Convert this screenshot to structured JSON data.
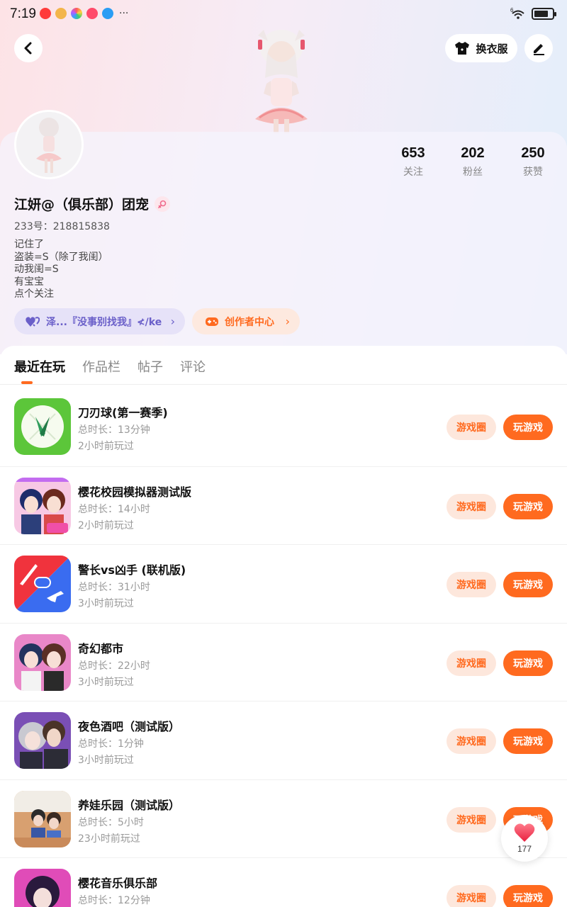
{
  "status_bar": {
    "time": "7:19",
    "more": "···",
    "signal": "6",
    "battery_level": 0.8
  },
  "header": {
    "back_icon": "chevron-left-icon",
    "outfit_label": "换衣服",
    "edit_icon": "pencil-icon"
  },
  "profile": {
    "stats": [
      {
        "value": "653",
        "label": "关注"
      },
      {
        "value": "202",
        "label": "粉丝"
      },
      {
        "value": "250",
        "label": "获赞"
      }
    ],
    "username": "江妍@（俱乐部）团宠",
    "gender_icon": "female-icon",
    "uid": "233号：218815838",
    "bio": [
      "记住了",
      "盗装=S（除了我闺）",
      "动我闺=S",
      "有宝宝",
      "点个关注"
    ],
    "club_chip": "泽...『没事别找我』≮/ke",
    "creator_chip": "创作者中心"
  },
  "tabs": [
    "最近在玩",
    "作品栏",
    "帖子",
    "评论"
  ],
  "active_tab": 0,
  "games": [
    {
      "title": "刀刃球(第一赛季)",
      "duration": "总时长：13分钟",
      "last_played": "2小时前玩过"
    },
    {
      "title": "樱花校园模拟器测试版",
      "duration": "总时长：14小时",
      "last_played": "2小时前玩过"
    },
    {
      "title": "警长vs凶手 (联机版)",
      "duration": "总时长：31小时",
      "last_played": "3小时前玩过"
    },
    {
      "title": "奇幻都市",
      "duration": "总时长：22小时",
      "last_played": "3小时前玩过"
    },
    {
      "title": "夜色酒吧（测试版）",
      "duration": "总时长：1分钟",
      "last_played": "3小时前玩过"
    },
    {
      "title": "养娃乐园（测试版）",
      "duration": "总时长：5小时",
      "last_played": "23小时前玩过"
    },
    {
      "title": "樱花音乐俱乐部",
      "duration": "总时长：12分钟",
      "last_played": ""
    }
  ],
  "buttons": {
    "circle": "游戏圈",
    "play": "玩游戏"
  },
  "like_float": {
    "count": "177",
    "icon": "heart-icon"
  },
  "colors": {
    "accent": "#ff6a1f",
    "accent_light": "#fde7dc",
    "club_purple": "#6a5fc9"
  }
}
